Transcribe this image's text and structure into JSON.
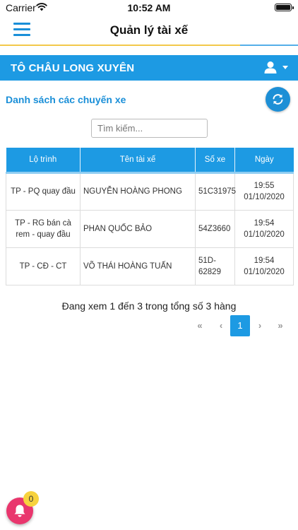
{
  "status_bar": {
    "carrier": "Carrier",
    "time": "10:52 AM",
    "wifi_icon": "wifi-icon",
    "battery_icon": "battery-icon"
  },
  "nav": {
    "title": "Quản lý tài xế",
    "menu_icon": "hamburger-menu-icon",
    "accent_color": "#1a8fd8"
  },
  "header": {
    "company": "TÔ CHÂU LONG XUYÊN",
    "user_icon": "user-icon",
    "background_color": "#1d9ae3"
  },
  "section": {
    "title": "Danh sách các chuyến xe",
    "refresh_icon": "refresh-icon"
  },
  "search": {
    "placeholder": "Tìm kiếm...",
    "value": ""
  },
  "table": {
    "columns": [
      "Lộ trình",
      "Tên tài xế",
      "Số xe",
      "Ngày"
    ],
    "rows": [
      {
        "route": "TP - PQ quay đầu",
        "driver": "NGUYỄN HOÀNG PHONG",
        "plate": "51C31975",
        "time": "19:55",
        "date": "01/10/2020"
      },
      {
        "route": "TP - RG bán cà rem - quay đầu",
        "driver": "PHAN QUỐC BẢO",
        "plate": "54Z3660",
        "time": "19:54",
        "date": "01/10/2020"
      },
      {
        "route": "TP - CĐ - CT",
        "driver": "VÕ THÁI HOÀNG TUẤN",
        "plate": "51D-62829",
        "time": "19:54",
        "date": "01/10/2020"
      }
    ]
  },
  "pagination": {
    "info": "Đang xem 1 đến 3 trong tổng số 3 hàng",
    "first": "«",
    "prev": "‹",
    "current": "1",
    "next": "›",
    "last": "»"
  },
  "notifications": {
    "count": "0",
    "bell_icon": "bell-icon",
    "button_color": "#e9366d",
    "badge_color": "#f7d23e"
  }
}
